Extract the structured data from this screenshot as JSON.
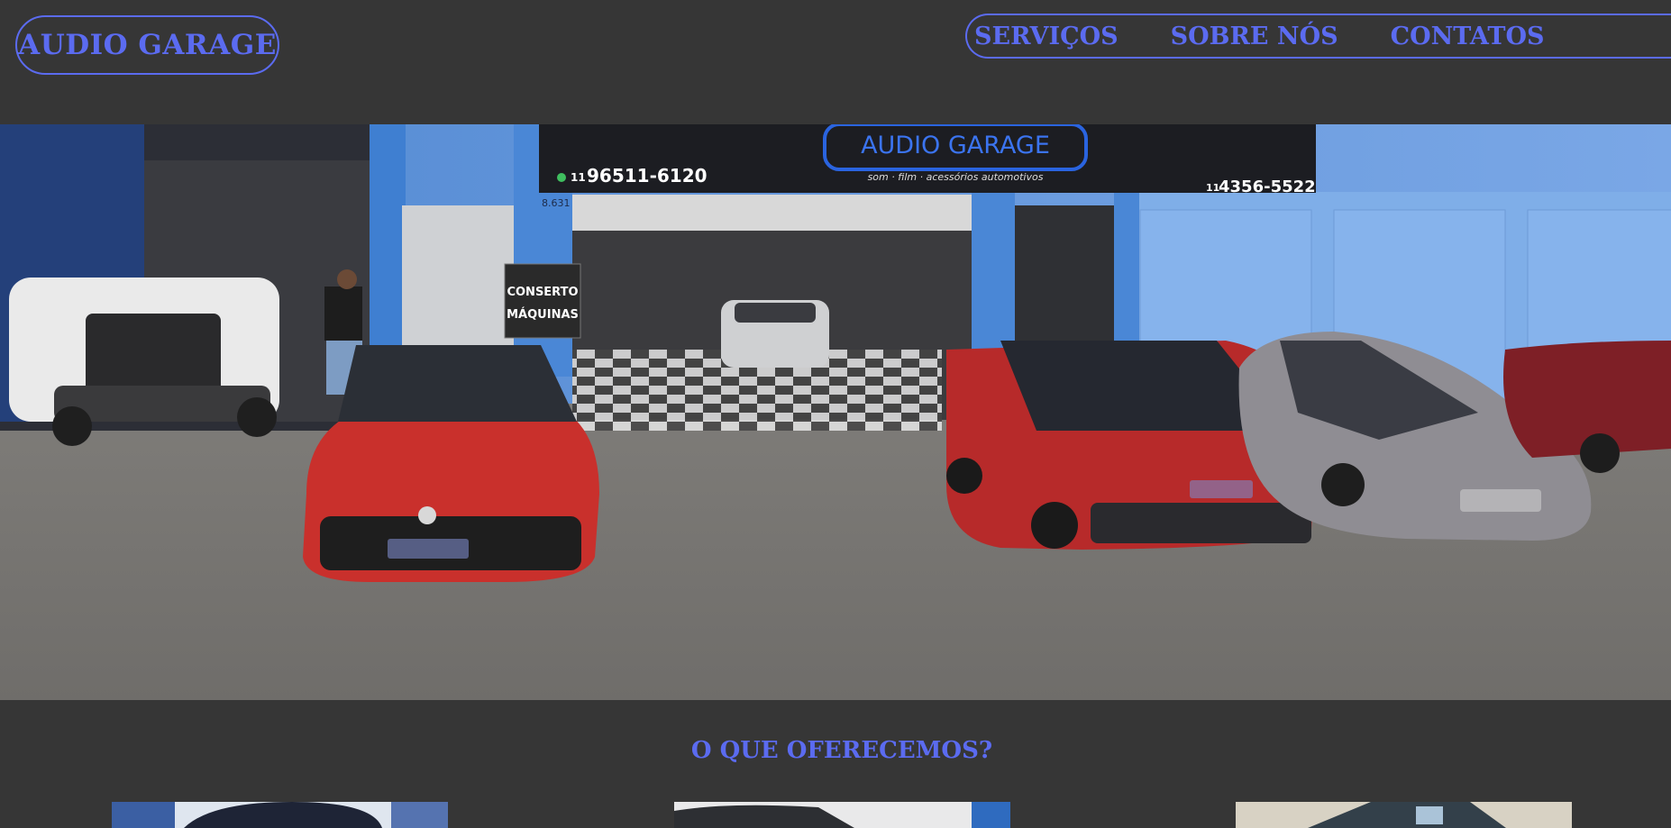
{
  "header": {
    "logo_text": "AUDIO GARAGE",
    "nav": [
      {
        "label": "SERVIÇOS"
      },
      {
        "label": "SOBRE NÓS"
      },
      {
        "label": "CONTATOS"
      }
    ]
  },
  "hero": {
    "sign_brand": "AUDIO GARAGE",
    "sign_tagline": "som · film · acessórios automotivos",
    "sign_phone_left": "96511-6120",
    "sign_phone_left_prefix": "11",
    "sign_phone_right": "4356-5522",
    "sign_phone_right_prefix": "11",
    "street_number": "8.631",
    "board_line1": "CONSERTO",
    "board_line2": "MÁQUINAS"
  },
  "offer": {
    "title": "O QUE OFERECEMOS?"
  },
  "colors": {
    "accent": "#5b6bf0",
    "background": "#363636"
  }
}
